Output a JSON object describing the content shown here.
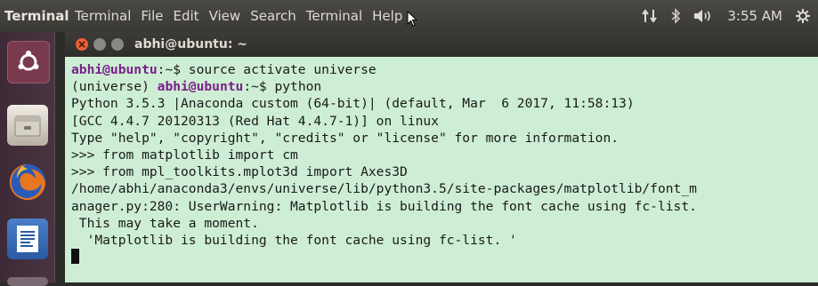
{
  "topbar": {
    "app_title": "Terminal",
    "menu": [
      "Terminal",
      "File",
      "Edit",
      "View",
      "Search",
      "Terminal",
      "Help"
    ],
    "clock": "3:55 AM",
    "indicator_icons": [
      "network-arrows-icon",
      "bluetooth-icon",
      "volume-icon",
      "settings-gear-icon"
    ]
  },
  "launcher": {
    "items": [
      "ubuntu-dash-icon",
      "files-icon",
      "firefox-icon",
      "libreoffice-writer-icon"
    ]
  },
  "window": {
    "title": "abhi@ubuntu: ~"
  },
  "terminal": {
    "lines": [
      {
        "prompt": "abhi@ubuntu",
        "pre": "",
        "post": ":~$ source activate universe"
      },
      {
        "pre": "(universe) ",
        "prompt": "abhi@ubuntu",
        "post": ":~$ python"
      },
      {
        "text": "Python 3.5.3 |Anaconda custom (64-bit)| (default, Mar  6 2017, 11:58:13)"
      },
      {
        "text": "[GCC 4.4.7 20120313 (Red Hat 4.4.7-1)] on linux"
      },
      {
        "text": "Type \"help\", \"copyright\", \"credits\" or \"license\" for more information."
      },
      {
        "text": ">>> from matplotlib import cm"
      },
      {
        "text": ">>> from mpl_toolkits.mplot3d import Axes3D"
      },
      {
        "text": "/home/abhi/anaconda3/envs/universe/lib/python3.5/site-packages/matplotlib/font_m"
      },
      {
        "text": "anager.py:280: UserWarning: Matplotlib is building the font cache using fc-list."
      },
      {
        "text": " This may take a moment."
      },
      {
        "text": "  'Matplotlib is building the font cache using fc-list. '"
      }
    ]
  },
  "colors": {
    "prompt": "#7a1f8a",
    "terminal_bg": "#cdeed4",
    "panel_bg": "#3a3935",
    "launcher_bg": "#4a3442"
  }
}
